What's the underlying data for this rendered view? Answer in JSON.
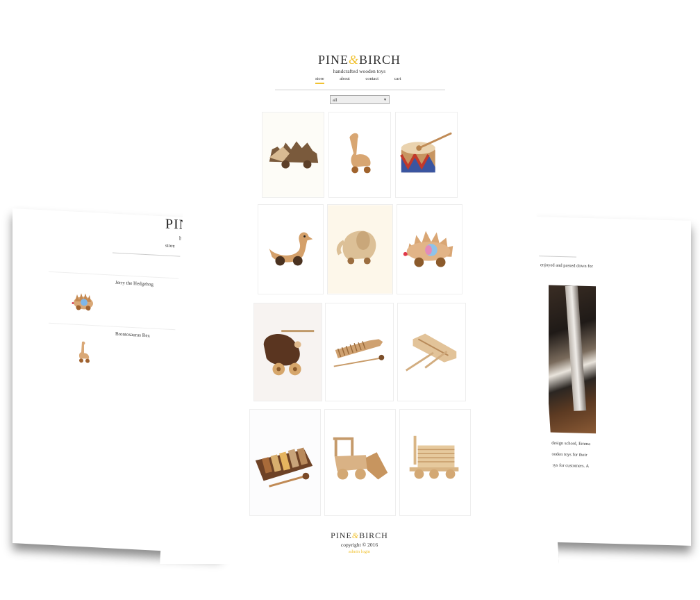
{
  "brand": {
    "name_left": "PINE",
    "amp": "&",
    "name_right": "BIRCH",
    "tagline": "handcrafted wooden toys",
    "accent_color": "#f1c232"
  },
  "nav": {
    "items": [
      "store",
      "about",
      "contact",
      "cart"
    ],
    "active": "store"
  },
  "filter": {
    "value": "all"
  },
  "products": [
    {
      "icon": "wooden-hedgehog-block-toy"
    },
    {
      "icon": "wooden-dinosaur-toy"
    },
    {
      "icon": "wooden-drum-toy"
    },
    {
      "icon": "wooden-duck-toy"
    },
    {
      "icon": "wooden-elephant-toy"
    },
    {
      "icon": "wooden-hedgehog-toy"
    },
    {
      "icon": "wooden-helicopter-toy"
    },
    {
      "icon": "wooden-guiro-instrument"
    },
    {
      "icon": "wooden-tone-block-instrument"
    },
    {
      "icon": "wooden-xylophone-toy"
    },
    {
      "icon": "wooden-bulldozer-toy"
    },
    {
      "icon": "wooden-log-truck-toy"
    }
  ],
  "footer": {
    "copyright": "copyright © 2016",
    "admin_link": "admin login"
  },
  "cart_page": {
    "logo_partial": "PIN",
    "nav_partial": "store",
    "items": [
      {
        "name": "Jerry the Hedgehog"
      },
      {
        "name": "Brontosauras Rex"
      }
    ]
  },
  "about_page": {
    "line1": "enjoyed and passed down for",
    "lines": [
      "ing at design school, Emma",
      "ting wooden toys for their",
      "ating toys for customers. A"
    ]
  }
}
